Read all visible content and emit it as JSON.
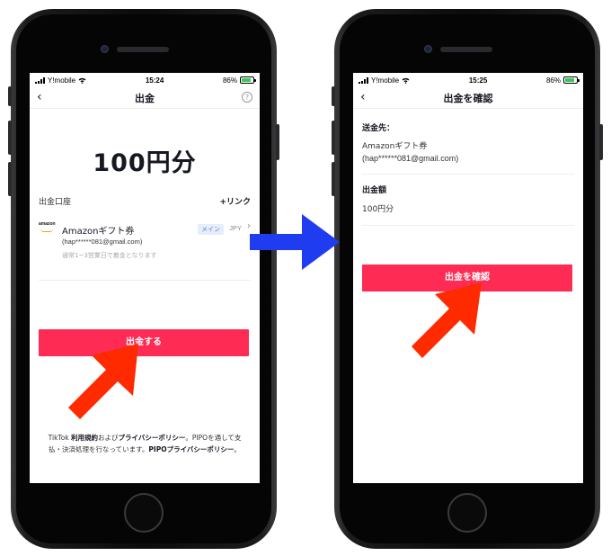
{
  "status_bar_left": {
    "carrier": "Y!mobile",
    "time": "15:24",
    "battery": "86%"
  },
  "status_bar_right": {
    "carrier": "Y!mobile",
    "time": "15:25",
    "battery": "86%"
  },
  "withdraw_screen": {
    "title": "出金",
    "help_icon_label": "?",
    "amount": "100円分",
    "account_label": "出金口座",
    "link_label": "+リンク",
    "gift_name": "Amazonギフト券",
    "gift_email": "(hap******081@gmail.com)",
    "gift_note": "通常1~3営業日で着金となります",
    "main_badge": "メイン",
    "currency": "JPY",
    "amazon_logo_text": "amazon",
    "submit_label": "出金する",
    "terms": {
      "part1": "TikTok ",
      "terms_link": "利用規約",
      "part2": "および",
      "privacy_link": "プライバシーポリシー",
      "part3": "。PIPOを通して支払・決済処理を行なっています。",
      "pipo_link": "PIPOプライバシーポリシー",
      "part4": "。"
    }
  },
  "confirm_screen": {
    "title": "出金を確認",
    "recipient_label": "送金先：",
    "recipient_name": "Amazonギフト券",
    "recipient_email": "(hap******081@gmail.com)",
    "amount_label": "出金額",
    "amount_value": "100円分",
    "confirm_label": "出金を確認"
  },
  "colors": {
    "primary_button": "#fe2c55",
    "annotation_arrow_red": "#ff2a00",
    "annotation_arrow_blue": "#1f3cf0",
    "main_badge_text": "#5a86d6"
  }
}
